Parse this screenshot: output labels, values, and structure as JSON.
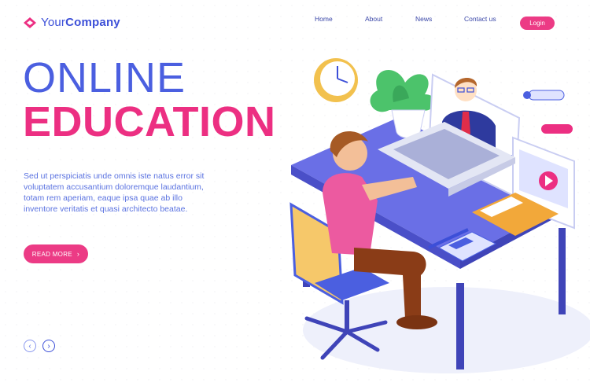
{
  "header": {
    "logo_icon": "diamond-logo-icon",
    "brand_first": "Your",
    "brand_second": "Company",
    "nav": [
      "Home",
      "About",
      "News",
      "Contact us"
    ],
    "login_label": "Login"
  },
  "hero": {
    "title_line1": "ONLINE",
    "title_line2": "EDUCATION",
    "description": "Sed ut perspiciatis unde omnis iste natus error sit voluptatem accusantium doloremque laudantium, totam rem aperiam, eaque ipsa quae ab illo inventore veritatis et quasi architecto beatae.",
    "cta_label": "READ MORE",
    "cta_icon": "chevron-right-icon"
  },
  "pager": {
    "prev_icon": "chevron-left-icon",
    "next_icon": "chevron-right-icon",
    "prev_glyph": "‹",
    "next_glyph": "›"
  },
  "colors": {
    "primary_blue": "#4b5fe0",
    "accent_pink": "#ec2f82",
    "desk_purple": "#5a5fd6"
  }
}
